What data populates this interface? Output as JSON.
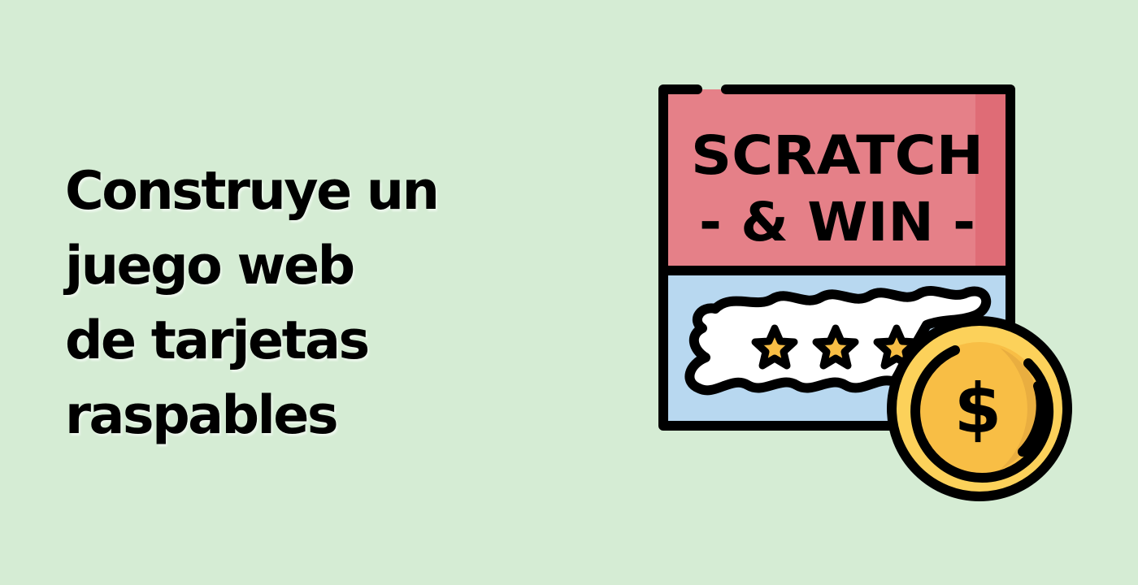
{
  "headline": {
    "line1": "Construye un",
    "line2": "juego web",
    "line3": "de tarjetas",
    "line4": "raspables"
  },
  "card": {
    "title_line1": "SCRATCH",
    "title_line2": "- & WIN -",
    "coin_symbol": "$",
    "stars_visible": 3
  },
  "colors": {
    "background": "#d5ecd4",
    "card_top": "#e58088",
    "card_top_shade": "#df6c76",
    "card_bottom": "#b8d8f0",
    "coin_outer": "#fcd15a",
    "coin_inner": "#f8be45",
    "star": "#f8be45",
    "outline": "#000000"
  },
  "icons": [
    "scratch-card-icon",
    "star-icon",
    "coin-icon",
    "dollar-icon"
  ]
}
